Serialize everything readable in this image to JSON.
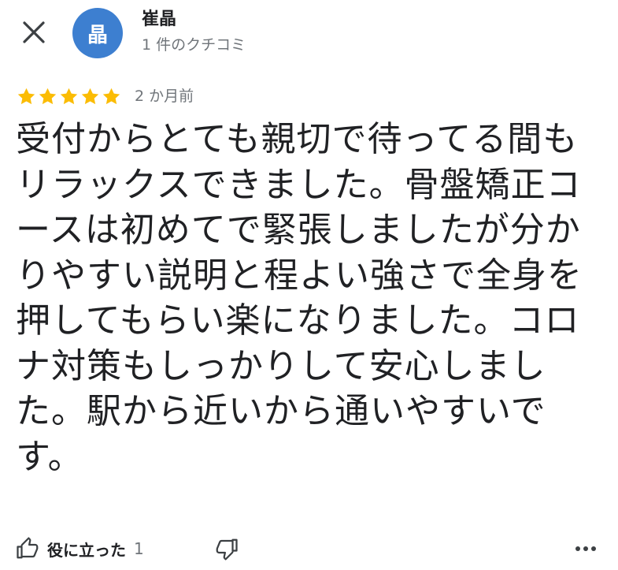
{
  "header": {
    "close_icon": "close-icon",
    "avatar_initial": "晶",
    "avatar_color": "#3d7fd0",
    "author_name": "崔晶",
    "review_count": "1 件のクチコミ"
  },
  "review": {
    "rating": 5,
    "max_rating": 5,
    "star_color": "#fbbc04",
    "time": "2 か月前",
    "text": "受付からとても親切で待ってる間もリラックスできました。骨盤矯正コースは初めてで緊張しましたが分かりやすい説明と程よい強さで全身を押してもらい楽になりました。コロナ対策もしっかりして安心しました。駅から近いから通いやすいです。"
  },
  "actions": {
    "helpful_icon": "thumbs-up-icon",
    "helpful_label": "役に立った",
    "helpful_count": "1",
    "dislike_icon": "thumbs-down-icon",
    "more_icon": "more-horizontal-icon"
  }
}
